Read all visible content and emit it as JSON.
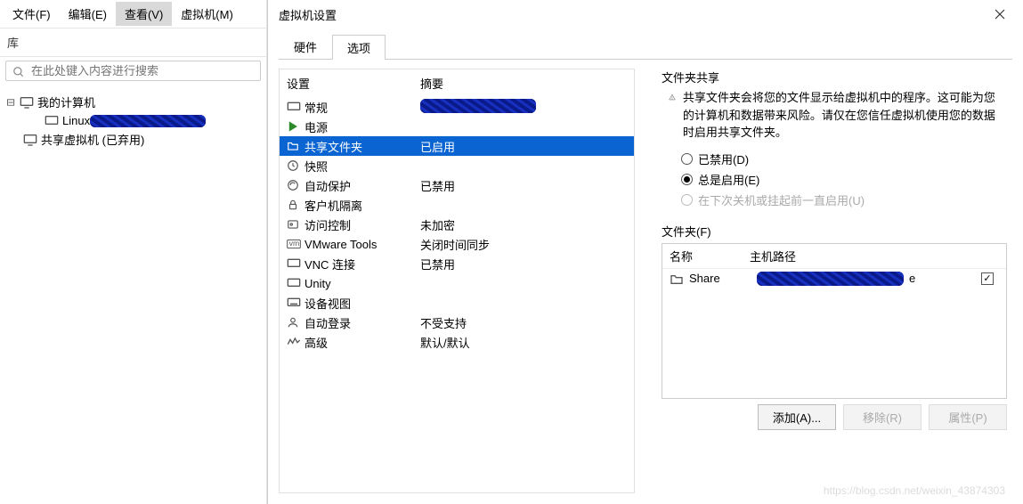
{
  "menu": {
    "file": "文件(F)",
    "edit": "编辑(E)",
    "view": "查看(V)",
    "vm": "虚拟机(M)"
  },
  "library": {
    "title": "库",
    "search_placeholder": "在此处键入内容进行搜索",
    "nodes": {
      "my_pc": "我的计算机",
      "linux": "Linux",
      "shared": "共享虚拟机 (已弃用)"
    }
  },
  "dialog": {
    "title": "虚拟机设置",
    "tabs": {
      "hw": "硬件",
      "opts": "选项"
    },
    "cols": {
      "setting": "设置",
      "summary": "摘要"
    },
    "rows": {
      "general": {
        "label": "常规",
        "value": ""
      },
      "power": {
        "label": "电源",
        "value": ""
      },
      "shared": {
        "label": "共享文件夹",
        "value": "已启用"
      },
      "snapshot": {
        "label": "快照",
        "value": ""
      },
      "autoprot": {
        "label": "自动保护",
        "value": "已禁用"
      },
      "guestiso": {
        "label": "客户机隔离",
        "value": ""
      },
      "access": {
        "label": "访问控制",
        "value": "未加密"
      },
      "tools": {
        "label": "VMware Tools",
        "value": "关闭时间同步"
      },
      "vnc": {
        "label": "VNC 连接",
        "value": "已禁用"
      },
      "unity": {
        "label": "Unity",
        "value": ""
      },
      "devview": {
        "label": "设备视图",
        "value": ""
      },
      "autologin": {
        "label": "自动登录",
        "value": "不受支持"
      },
      "advanced": {
        "label": "高级",
        "value": "默认/默认"
      }
    },
    "share_group": "文件夹共享",
    "share_notice": "共享文件夹会将您的文件显示给虚拟机中的程序。这可能为您的计算机和数据带来风险。请仅在您信任虚拟机使用您的数据时启用共享文件夹。",
    "radios": {
      "disabled": "已禁用(D)",
      "always": "总是启用(E)",
      "until": "在下次关机或挂起前一直启用(U)"
    },
    "folders_label": "文件夹(F)",
    "folders_cols": {
      "name": "名称",
      "path": "主机路径"
    },
    "folder_row": {
      "name": "Share",
      "path_tail": "e"
    },
    "buttons": {
      "add": "添加(A)...",
      "remove": "移除(R)",
      "props": "属性(P)"
    }
  },
  "watermark": "https://blog.csdn.net/weixin_43874303"
}
